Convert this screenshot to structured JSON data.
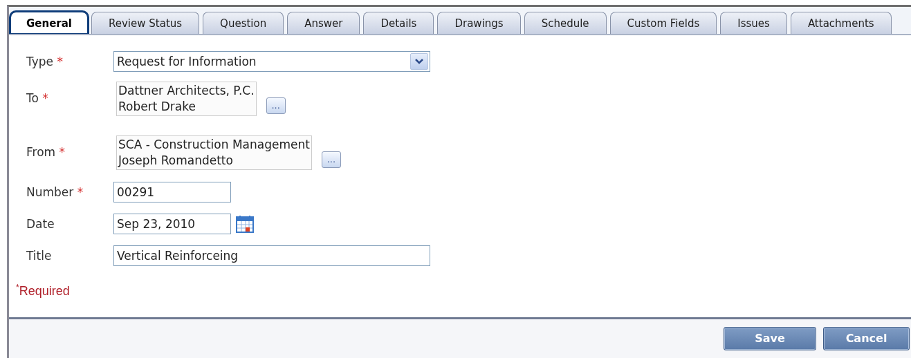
{
  "tabs": [
    {
      "label": "General",
      "selected": true
    },
    {
      "label": "Review Status",
      "selected": false
    },
    {
      "label": "Question",
      "selected": false
    },
    {
      "label": "Answer",
      "selected": false
    },
    {
      "label": "Details",
      "selected": false
    },
    {
      "label": "Drawings",
      "selected": false
    },
    {
      "label": "Schedule",
      "selected": false
    },
    {
      "label": "Custom Fields",
      "selected": false
    },
    {
      "label": "Issues",
      "selected": false
    },
    {
      "label": "Attachments",
      "selected": false
    }
  ],
  "fields": [
    {
      "kind": "select",
      "label": "Type",
      "required": true,
      "value": "Request for Information"
    },
    {
      "kind": "picker",
      "label": "To",
      "required": true,
      "lines": [
        "Dattner Architects, P.C.",
        "Robert Drake"
      ],
      "button": "..."
    },
    {
      "kind": "picker",
      "label": "From",
      "required": true,
      "lines": [
        "SCA - Construction Management",
        "Joseph Romandetto"
      ],
      "button": "..."
    },
    {
      "kind": "text",
      "label": "Number",
      "required": true,
      "value": "00291"
    },
    {
      "kind": "date",
      "label": "Date",
      "required": false,
      "value": "Sep 23, 2010"
    },
    {
      "kind": "wide",
      "label": "Title",
      "required": false,
      "value": "Vertical Reinforceing"
    }
  ],
  "required_note": {
    "mark": "*",
    "text": "Required"
  },
  "required_mark": "*",
  "buttons": [
    "Save",
    "Cancel"
  ]
}
